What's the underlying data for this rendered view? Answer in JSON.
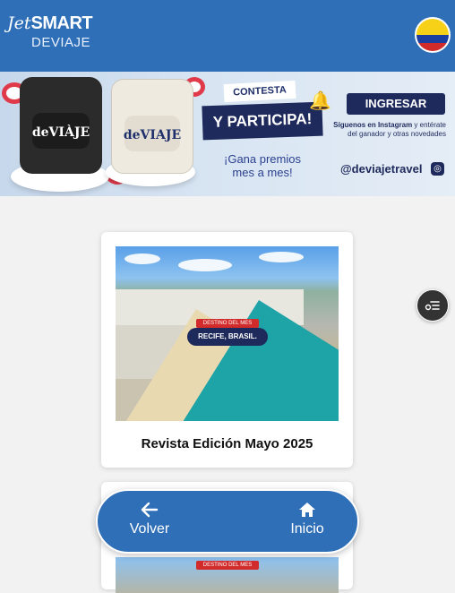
{
  "header": {
    "logo_jet": "Jet",
    "logo_smart": "SMART",
    "logo_deviaje": "DEVIAJE",
    "flag_icon": "colombia-flag-icon"
  },
  "banner": {
    "bag_label_1": "deVIÀJE",
    "bag_label_2": "deVIAJE",
    "contesta": "CONTESTA",
    "participa": "Y PARTICIPA!",
    "gana_line1": "¡Gana premios",
    "gana_line2": "mes a mes!",
    "ingresar": "INGRESAR",
    "siguenos_bold": "Síguenos en Instagram",
    "siguenos_rest": " y entérate del ganador y otras novedades",
    "handle": "@deviajetravel",
    "colors": {
      "navy": "#1f2a5c",
      "accent_red": "#e03a4a"
    }
  },
  "cards": [
    {
      "title": "Revista Edición Mayo 2025",
      "tag": "DESTINO DEL MES",
      "place": "RECIFE, BRASIL."
    },
    {
      "title": "",
      "tag": "DESTINO DEL MES",
      "place": ""
    }
  ],
  "fab": {
    "icon": "filter-list-icon"
  },
  "bottom_nav": {
    "back_label": "Volver",
    "back_icon": "arrow-left-icon",
    "home_label": "Inicio",
    "home_icon": "home-icon"
  },
  "colors": {
    "primary": "#2f6fb8",
    "background": "#f2f2f2"
  }
}
